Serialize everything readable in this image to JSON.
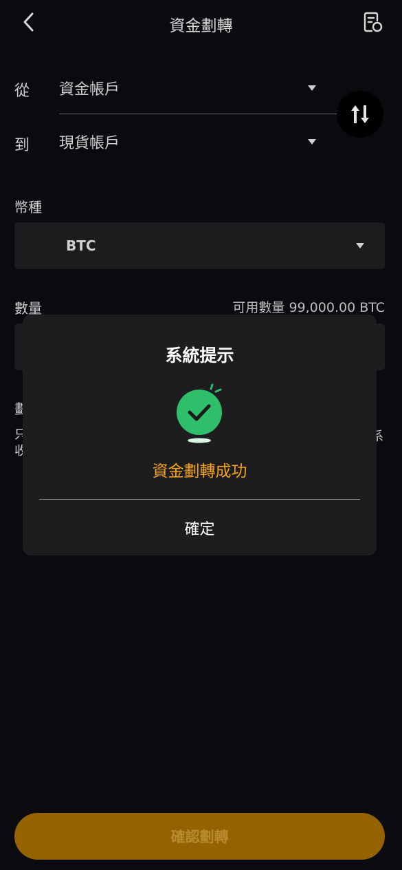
{
  "header": {
    "title": "資金劃轉",
    "back_icon": "chevron-left-icon",
    "record_icon": "record-icon"
  },
  "transfer": {
    "from_label": "從",
    "from_value": "資金帳戶",
    "to_label": "到",
    "to_value": "現貨帳戶",
    "swap_icon": "swap-arrows-icon"
  },
  "currency": {
    "label": "幣種",
    "value": "BTC"
  },
  "amount": {
    "label": "數量",
    "available": "可用數量 99,000.00 BTC"
  },
  "notes": {
    "title": "劃",
    "text_line1": "只",
    "text_line2": "收",
    "trailing_char": "系"
  },
  "footer": {
    "confirm_label": "確認劃轉"
  },
  "modal": {
    "title": "系統提示",
    "message": "資金劃轉成功",
    "ok_label": "確定",
    "icon": "success-check-icon"
  },
  "colors": {
    "background": "#0b0b0f",
    "card": "#1c1c1e",
    "accent": "#946300",
    "success_green": "#2fbf6b",
    "message_orange": "#f3a31a"
  }
}
